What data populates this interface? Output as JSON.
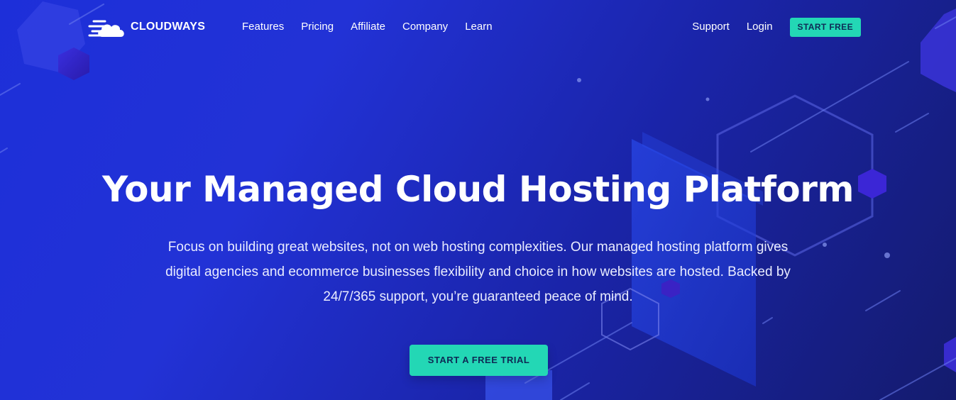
{
  "brand": {
    "name": "CLOUDWAYS",
    "logo_icon": "cloud-speed-icon"
  },
  "nav": {
    "items": [
      {
        "label": "Features"
      },
      {
        "label": "Pricing"
      },
      {
        "label": "Affiliate"
      },
      {
        "label": "Company"
      },
      {
        "label": "Learn"
      }
    ],
    "support_label": "Support",
    "login_label": "Login",
    "start_free_label": "START FREE"
  },
  "hero": {
    "title": "Your Managed Cloud Hosting Platform",
    "subtitle": "Focus on building great websites, not on web hosting complexities. Our managed hosting platform gives digital agencies and ecommerce businesses flexibility and choice in how websites are hosted. Backed by 24/7/365 support, you’re guaranteed peace of mind.",
    "cta_label": "START A FREE TRIAL"
  },
  "colors": {
    "background_start": "#1d2fd9",
    "background_end": "#141b6e",
    "accent": "#23d7b5",
    "button_text": "#0e2a55"
  }
}
